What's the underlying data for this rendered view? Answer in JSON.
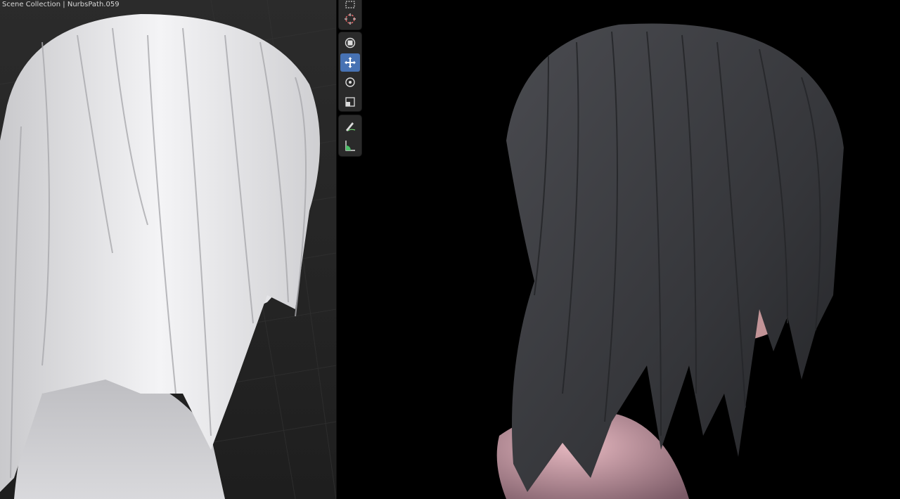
{
  "viewport": {
    "title": "Scene Collection | NurbsPath.059"
  },
  "toolbar": {
    "tools": [
      {
        "name": "select-box",
        "icon": "select-box-icon",
        "active": false
      },
      {
        "name": "cursor",
        "icon": "cursor-icon",
        "active": false
      },
      {
        "name": "transform",
        "icon": "transform-icon",
        "active": false
      },
      {
        "name": "move",
        "icon": "move-icon",
        "active": true
      },
      {
        "name": "rotate",
        "icon": "rotate-icon",
        "active": false
      },
      {
        "name": "scale",
        "icon": "scale-icon",
        "active": false
      },
      {
        "name": "annotate",
        "icon": "annotate-icon",
        "active": false
      },
      {
        "name": "measure",
        "icon": "measure-icon",
        "active": false
      }
    ]
  },
  "colors": {
    "active_tool": "#4772b3",
    "viewport_bg": "#262626",
    "render_bg": "#000000",
    "clay_hair": "#e6e6e8",
    "render_hair": "#3a3b3f",
    "skin": "#d7a6a6"
  }
}
